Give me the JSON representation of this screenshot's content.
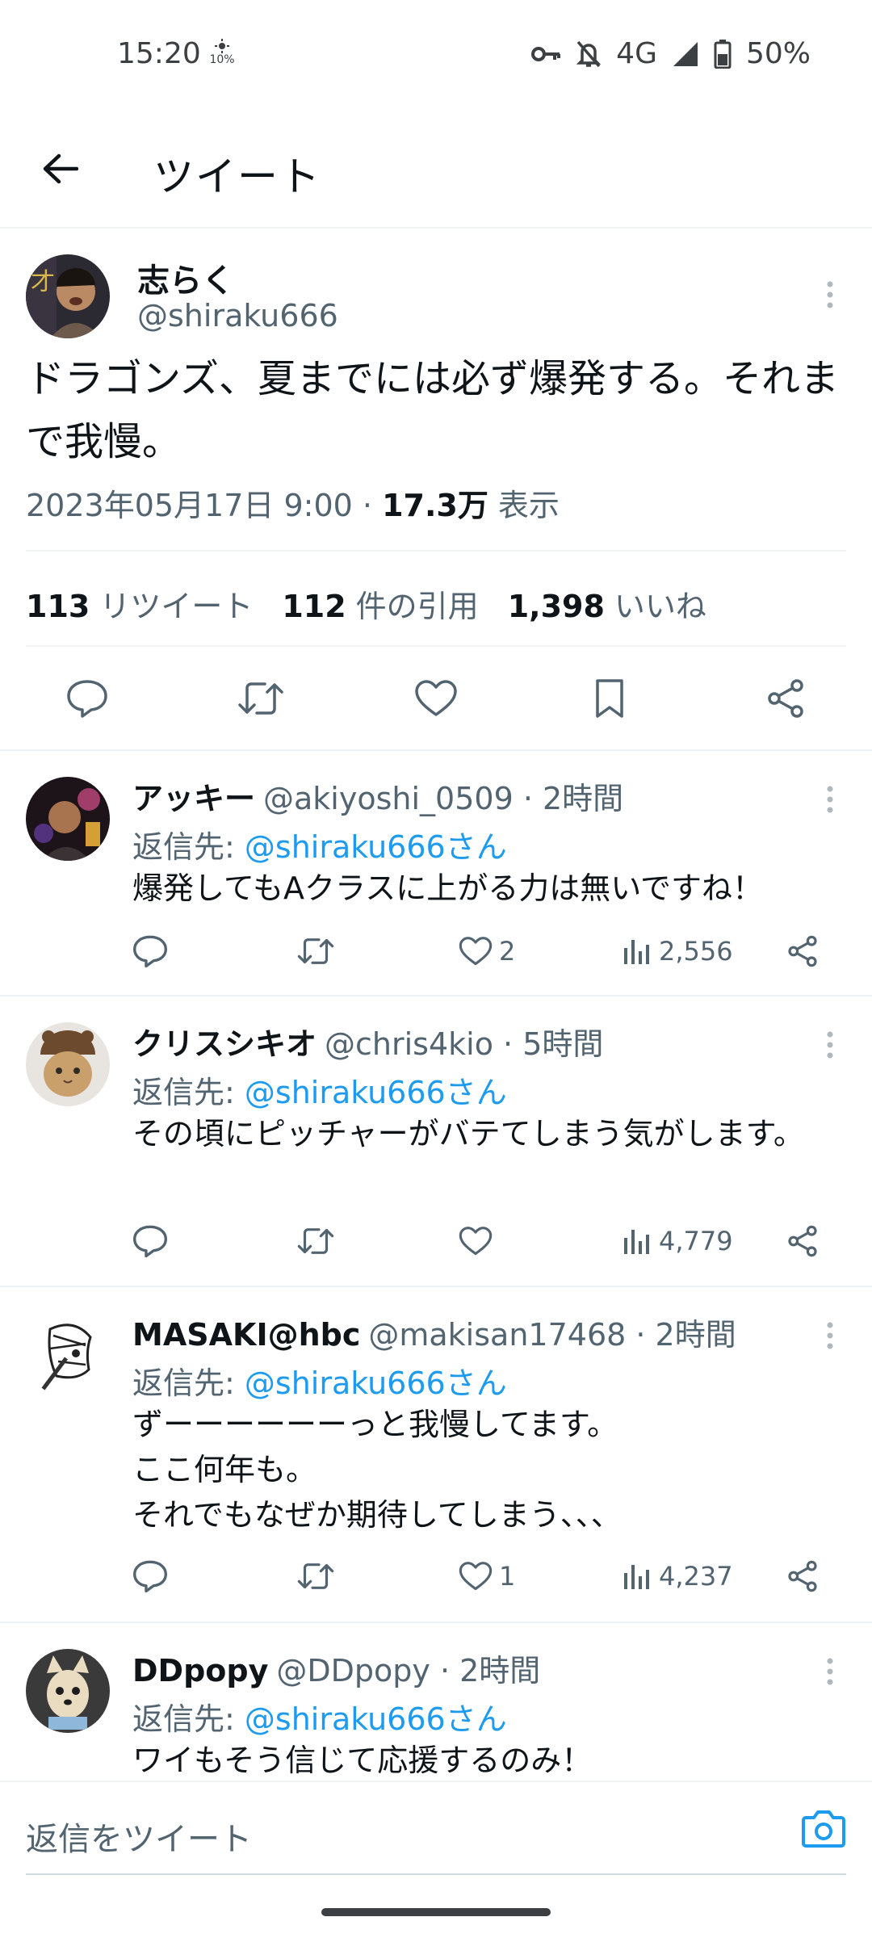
{
  "status_bar": {
    "time": "15:20",
    "small_indicator": "10%",
    "network": "4G",
    "battery": "50%",
    "icons": [
      "sun-icon",
      "key-icon",
      "bell-off-icon",
      "signal-icon",
      "battery-icon"
    ]
  },
  "header": {
    "title": "ツイート",
    "back_icon": "arrow-left-icon"
  },
  "main_tweet": {
    "name": "志らく",
    "handle": "@shiraku666",
    "text": "ドラゴンズ、夏までには必ず爆発する。それまで我慢。",
    "date": "2023年05月17日 9:00 · ",
    "views_count": "17.3万",
    "views_label": " 表示",
    "retweets_count": "113",
    "retweets_label": "リツイート",
    "quotes_count": "112",
    "quotes_label": "件の引用",
    "likes_count": "1,398",
    "likes_label": "いいね",
    "actions": [
      "reply-icon",
      "retweet-icon",
      "like-icon",
      "bookmark-icon",
      "share-icon"
    ]
  },
  "replies": [
    {
      "name": "アッキー",
      "handle": "@akiyoshi_0509",
      "time": " · 2時間",
      "reply_to_label": "返信先: ",
      "reply_to": "@shiraku666さん",
      "text": "爆発してもAクラスに上がる力は無いですね！",
      "likes": "2",
      "views": "2,556"
    },
    {
      "name": "クリスシキオ",
      "handle": "@chris4kio",
      "time": " · 5時間",
      "reply_to_label": "返信先: ",
      "reply_to": "@shiraku666さん",
      "text": "その頃にピッチャーがバテてしまう気がします。",
      "likes": "",
      "views": "4,779"
    },
    {
      "name": "MASAKI@hbc",
      "handle": "@makisan17468",
      "time": " · 2時間",
      "reply_to_label": "返信先: ",
      "reply_to": "@shiraku666さん",
      "text": "ずーーーーーーっと我慢してます。\nここ何年も。\nそれでもなぜか期待してしまう、、、",
      "likes": "1",
      "views": "4,237"
    },
    {
      "name": "DDpopy",
      "handle": "@DDpopy",
      "time": " · 2時間",
      "reply_to_label": "返信先: ",
      "reply_to": "@shiraku666さん",
      "text": "ワイもそう信じて応援するのみ！"
    }
  ],
  "composer": {
    "placeholder": "返信をツイート",
    "camera_icon": "camera-icon"
  },
  "colors": {
    "accent": "#1d9bf0",
    "text": "#0f1419",
    "muted": "#536471",
    "divider": "#eff3f4"
  }
}
